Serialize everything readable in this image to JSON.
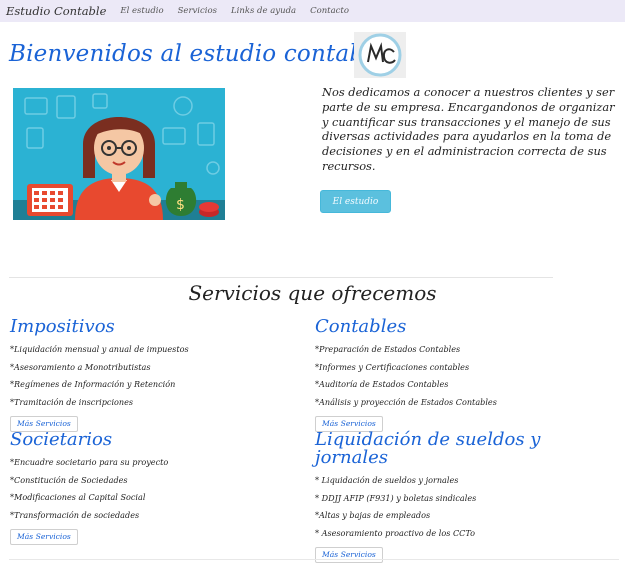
{
  "nav": {
    "brand": "Estudio Contable",
    "links": [
      "El estudio",
      "Servicios",
      "Links de ayuda",
      "Contacto"
    ]
  },
  "hero": {
    "title": "Bienvenidos al estudio contable",
    "logo_text": "MC",
    "intro": "Nos dedicamos a conocer a nuestros clientes y ser parte de su empresa. Encargandonos de organizar y cuantificar sus transacciones y el manejo de sus diversas actividades para ayudarlos en la toma de decisiones y en el administracion correcta de sus recursos.",
    "button_label": "El estudio"
  },
  "services": {
    "title": "Servicios que ofrecemos",
    "columns": [
      {
        "heading": "Impositivos",
        "items": [
          "*Liquidación mensual y anual de impuestos",
          "*Asesoramiento a Monotributistas",
          "*Regímenes de Información y Retención",
          "*Tramitación de inscripciones"
        ],
        "button_label": "Más Servicios"
      },
      {
        "heading": "Contables",
        "items": [
          "*Preparación de Estados Contables",
          "*Informes y Certificaciones contables",
          "*Auditoría de Estados Contables",
          "*Análisis y proyección de Estados Contables"
        ],
        "button_label": "Más Servicios"
      },
      {
        "heading": "Societarios",
        "items": [
          "*Encuadre societario para su proyecto",
          "*Constitución de Sociedades",
          "*Modificaciones al Capital Social",
          "*Transformación de sociedades"
        ],
        "button_label": "Más Servicios"
      },
      {
        "heading": "Liquidación de sueldos y jornales",
        "items": [
          "* Liquidación de sueldos y jornales",
          "* DDJJ AFIP (F931) y boletas sindicales",
          "*Altas y bajas de empleados",
          "* Asesoramiento proactivo de los CCTo"
        ],
        "button_label": "Más Servicios"
      }
    ]
  },
  "colors": {
    "accent_blue": "#1a63d6",
    "navbar_bg": "#ece9f7",
    "button_info": "#5bc0de",
    "illustration_bg": "#2bb2d3"
  }
}
